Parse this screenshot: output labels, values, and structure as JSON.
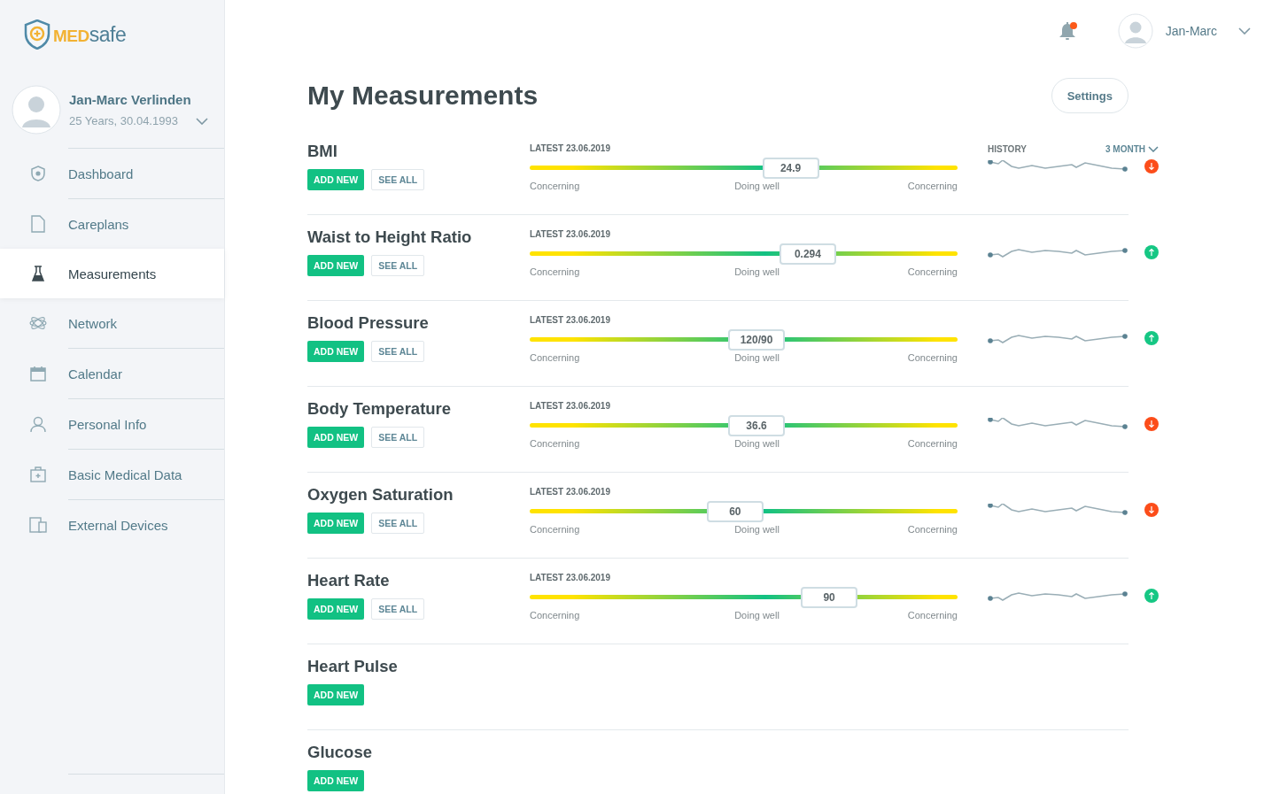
{
  "logo": {
    "part_1": "MED",
    "part_2": "safe"
  },
  "profile": {
    "name": "Jan-Marc Verlinden",
    "details": "25 Years, 30.04.1993"
  },
  "sidebar": {
    "items": [
      {
        "label": "Dashboard",
        "selected": false
      },
      {
        "label": "Careplans",
        "selected": false
      },
      {
        "label": "Measurements",
        "selected": true
      },
      {
        "label": "Network",
        "selected": false
      },
      {
        "label": "Calendar",
        "selected": false
      },
      {
        "label": "Personal Info",
        "selected": false
      },
      {
        "label": "Basic Medical Data",
        "selected": false
      },
      {
        "label": "External Devices",
        "selected": false
      }
    ]
  },
  "topbar": {
    "unread_notifications": true,
    "user_name": "Jan-Marc"
  },
  "page": {
    "title": "My Measurements",
    "settings_button": "Settings"
  },
  "history": {
    "label": "HISTORY",
    "period": "3 MONTH"
  },
  "measurements": [
    {
      "name": "BMI",
      "add_button": "ADD NEW",
      "see_all_button": "SEE ALL",
      "latest": "LATEST 23.06.2019",
      "reading": "24.9",
      "level": 0.61,
      "scale": [
        "Concerning",
        "Doing well",
        "Concerning"
      ],
      "kind": "down"
    },
    {
      "name": "Waist to Height Ratio",
      "add_button": "ADD NEW",
      "see_all_button": "SEE ALL",
      "latest": "LATEST 23.06.2019",
      "reading": "0.294",
      "level": 0.65,
      "scale": [
        "Concerning",
        "Doing well",
        "Concerning"
      ],
      "kind": "up"
    },
    {
      "name": "Blood Pressure",
      "add_button": "ADD NEW",
      "see_all_button": "SEE ALL",
      "latest": "LATEST 23.06.2019",
      "reading": "120/90",
      "level": 0.53,
      "scale": [
        "Concerning",
        "Doing well",
        "Concerning"
      ],
      "kind": "up"
    },
    {
      "name": "Body Temperature",
      "add_button": "ADD NEW",
      "see_all_button": "SEE ALL",
      "latest": "LATEST 23.06.2019",
      "reading": "36.6",
      "level": 0.53,
      "scale": [
        "Concerning",
        "Doing well",
        "Concerning"
      ],
      "kind": "down"
    },
    {
      "name": "Oxygen Saturation",
      "add_button": "ADD NEW",
      "see_all_button": "SEE ALL",
      "latest": "LATEST 23.06.2019",
      "reading": "60",
      "level": 0.48,
      "scale": [
        "Concerning",
        "Doing well",
        "Concerning"
      ],
      "kind": "down"
    },
    {
      "name": "Heart Rate",
      "add_button": "ADD NEW",
      "see_all_button": "SEE ALL",
      "latest": "LATEST 23.06.2019",
      "reading": "90",
      "level": 0.7,
      "scale": [
        "Concerning",
        "Doing well",
        "Concerning"
      ],
      "kind": "up"
    },
    {
      "name": "Heart Pulse",
      "add_button": "ADD NEW"
    },
    {
      "name": "Glucose",
      "add_button": "ADD NEW"
    }
  ]
}
